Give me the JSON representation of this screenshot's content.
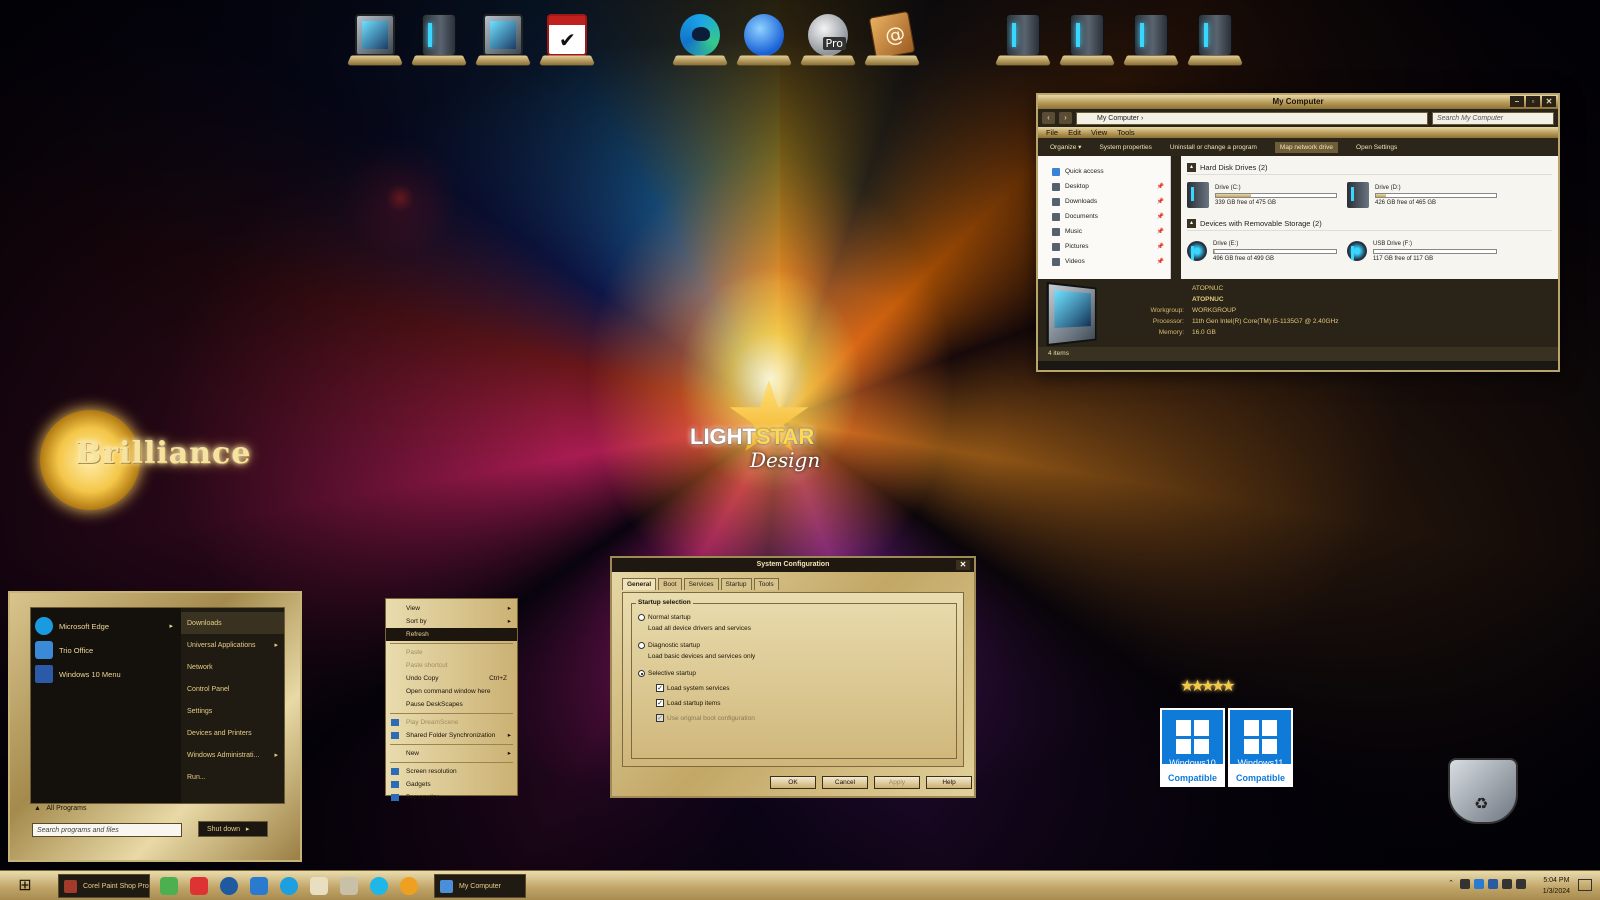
{
  "dock": [
    {
      "name": "computer-icon"
    },
    {
      "name": "tower-icon"
    },
    {
      "name": "network-icon"
    },
    {
      "name": "checklist-icon"
    },
    {
      "name": "edge-icon"
    },
    {
      "name": "thunderbird-icon"
    },
    {
      "name": "google-earth-pro-icon",
      "badge": "Pro"
    },
    {
      "name": "address-book-icon"
    },
    {
      "name": "drive-tower-icon-1"
    },
    {
      "name": "drive-tower-icon-2"
    },
    {
      "name": "drive-tower-icon-3"
    },
    {
      "name": "drive-tower-icon-4"
    }
  ],
  "explorer": {
    "title": "My Computer",
    "address": "My Computer",
    "search_placeholder": "Search My Computer",
    "menu": [
      "File",
      "Edit",
      "View",
      "Tools"
    ],
    "commands": [
      "Organize ▾",
      "System properties",
      "Uninstall or change a program",
      "Map network drive",
      "Open Settings"
    ],
    "active_command_index": 3,
    "nav": [
      "Quick access",
      "Desktop",
      "Downloads",
      "Documents",
      "Music",
      "Pictures",
      "Videos"
    ],
    "group1": "Hard Disk Drives (2)",
    "group2": "Devices with Removable Storage (2)",
    "drives": [
      {
        "label": "Drive (C:)",
        "free": "339 GB free of 475 GB",
        "used_fraction": 0.29
      },
      {
        "label": "Drive (D:)",
        "free": "426 GB free of 465 GB",
        "used_fraction": 0.08
      },
      {
        "label": "Drive (E:)",
        "free": "496 GB free of 499 GB",
        "used_fraction": 0.01
      },
      {
        "label": "USB Drive (F:)",
        "free": "117 GB free of 117 GB",
        "used_fraction": 0.0
      }
    ],
    "details": {
      "name": "ATOPNUC",
      "name2": "ATOPNUC",
      "workgroup_label": "Workgroup:",
      "workgroup": "WORKGROUP",
      "processor_label": "Processor:",
      "processor": "11th Gen Intel(R) Core(TM) i5-1135G7 @ 2.40GHz",
      "memory_label": "Memory:",
      "memory": "16.0 GB"
    },
    "status": "4 items"
  },
  "brilliance": {
    "text": "Brilliance"
  },
  "lightstar": {
    "light": "LIGHT",
    "star": "STAR",
    "design": "Design"
  },
  "startmenu": {
    "programs": [
      {
        "label": "Microsoft Edge",
        "color": "#1a9be0",
        "submenu": true
      },
      {
        "label": "Trio Office",
        "color": "#3a8ad8",
        "submenu": false
      },
      {
        "label": "Windows 10 Menu",
        "color": "#2a5aa8",
        "submenu": false
      }
    ],
    "links": [
      {
        "label": "Downloads",
        "submenu": false
      },
      {
        "label": "Universal Applications",
        "submenu": true
      },
      {
        "label": "Network",
        "submenu": false
      },
      {
        "label": "Control Panel",
        "submenu": false
      },
      {
        "label": "Settings",
        "submenu": false
      },
      {
        "label": "Devices and Printers",
        "submenu": false
      },
      {
        "label": "Windows Administrati...",
        "submenu": true
      },
      {
        "label": "Run...",
        "submenu": false
      }
    ],
    "all_programs": "All Programs",
    "search_placeholder": "Search programs and files",
    "shutdown": "Shut down"
  },
  "context_menu": [
    {
      "label": "View",
      "arrow": true
    },
    {
      "label": "Sort by",
      "arrow": true
    },
    {
      "label": "Refresh",
      "selected": true
    },
    {
      "sep": true
    },
    {
      "label": "Paste",
      "disabled": true
    },
    {
      "label": "Paste shortcut",
      "disabled": true
    },
    {
      "label": "Undo Copy",
      "shortcut": "Ctrl+Z"
    },
    {
      "label": "Open command window here"
    },
    {
      "label": "Pause DeskScapes"
    },
    {
      "sep": true
    },
    {
      "label": "Play DreamScene",
      "disabled": true,
      "icon": true
    },
    {
      "label": "Shared Folder Synchronization",
      "arrow": true,
      "icon": true
    },
    {
      "sep": true
    },
    {
      "label": "New",
      "arrow": true
    },
    {
      "sep": true
    },
    {
      "label": "Screen resolution",
      "icon": true
    },
    {
      "label": "Gadgets",
      "icon": true
    },
    {
      "label": "Personalize",
      "icon": true
    }
  ],
  "syscfg": {
    "title": "System Configuration",
    "close": "✕",
    "tabs": [
      "General",
      "Boot",
      "Services",
      "Startup",
      "Tools"
    ],
    "group": "Startup selection",
    "normal": "Normal startup",
    "normal_desc": "Load all device drivers and services",
    "diagnostic": "Diagnostic startup",
    "diagnostic_desc": "Load basic devices and services only",
    "selective": "Selective startup",
    "load_services": "Load system services",
    "load_startup": "Load startup items",
    "use_boot": "Use original boot configuration",
    "buttons": {
      "ok": "OK",
      "cancel": "Cancel",
      "apply": "Apply",
      "help": "Help"
    }
  },
  "compat": [
    {
      "version": "Windows10",
      "label": "Compatible"
    },
    {
      "version": "Windows11",
      "label": "Compatible"
    }
  ],
  "taskbar": {
    "tasks": [
      "Corel Paint Shop Pro ...",
      "My Computer"
    ],
    "time": "5:04 PM",
    "date": "1/3/2024"
  }
}
